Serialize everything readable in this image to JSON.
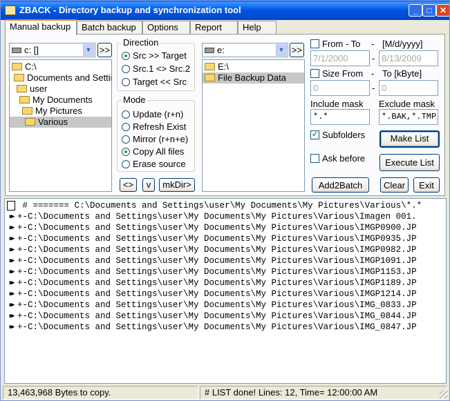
{
  "window": {
    "title": "ZBACK - Directory backup and synchronization tool",
    "controls": [
      "_",
      "□",
      "✕"
    ]
  },
  "tabs": [
    {
      "label": "Manual backup",
      "active": true
    },
    {
      "label": "Batch backup",
      "active": false
    },
    {
      "label": "Options",
      "active": false
    },
    {
      "label": "Report",
      "active": false
    },
    {
      "label": "Help",
      "active": false
    }
  ],
  "source": {
    "drive": "c: []",
    "nav_button": ">>",
    "tree": [
      {
        "label": "C:\\",
        "selected": false
      },
      {
        "label": "Documents and Settings",
        "selected": false
      },
      {
        "label": "user",
        "selected": false
      },
      {
        "label": "My Documents",
        "selected": false
      },
      {
        "label": "My Pictures",
        "selected": false
      },
      {
        "label": "Various",
        "selected": true
      }
    ]
  },
  "target": {
    "drive": "e:",
    "nav_button": ">>",
    "tree": [
      {
        "label": "E:\\",
        "selected": false
      },
      {
        "label": "File Backup Data",
        "selected": true
      }
    ]
  },
  "direction": {
    "legend": "Direction",
    "options": [
      {
        "label": "Src >> Target",
        "checked": true
      },
      {
        "label": "Src.1 <> Src.2",
        "checked": false
      },
      {
        "label": "Target << Src",
        "checked": false
      }
    ]
  },
  "mode": {
    "legend": "Mode",
    "options": [
      {
        "label": "Update (r+n)",
        "checked": false
      },
      {
        "label": "Refresh Exist",
        "checked": false
      },
      {
        "label": "Mirror (r+n+e)",
        "checked": false
      },
      {
        "label": "Copy All files",
        "checked": true
      },
      {
        "label": "Erase source",
        "checked": false
      }
    ]
  },
  "small_buttons": {
    "swap": "<>",
    "down": "v",
    "mkdir": "mkDir>"
  },
  "filters": {
    "from_to_label": "From  - To",
    "dash": "-",
    "date_format": "[M/d/yyyy]",
    "date_from": "7/1/2000",
    "date_to": "8/13/2009",
    "size_label": "Size From",
    "size_to_label": "To [kByte]",
    "size_from": "0",
    "size_to": "0",
    "include_label": "Include mask",
    "exclude_label": "Exclude mask",
    "include_mask": "*.*",
    "exclude_mask": "*.BAK,*.TMP",
    "subfolders_label": "Subfolders",
    "subfolders_checked": true,
    "ask_before_label": "Ask before",
    "ask_before_checked": false
  },
  "actions": {
    "make_list": "Make List",
    "execute_list": "Execute List",
    "add2batch": "Add2Batch",
    "clear": "Clear",
    "exit": "Exit"
  },
  "log": {
    "header": "# ======= C:\\Documents and Settings\\user\\My Documents\\My Pictures\\Various\\*.*",
    "lines": [
      "+-C:\\Documents and Settings\\user\\My Documents\\My Pictures\\Various\\Imagen 001.",
      "+-C:\\Documents and Settings\\user\\My Documents\\My Pictures\\Various\\IMGP0900.JP",
      "+-C:\\Documents and Settings\\user\\My Documents\\My Pictures\\Various\\IMGP0935.JP",
      "+-C:\\Documents and Settings\\user\\My Documents\\My Pictures\\Various\\IMGP0982.JP",
      "+-C:\\Documents and Settings\\user\\My Documents\\My Pictures\\Various\\IMGP1091.JP",
      "+-C:\\Documents and Settings\\user\\My Documents\\My Pictures\\Various\\IMGP1153.JP",
      "+-C:\\Documents and Settings\\user\\My Documents\\My Pictures\\Various\\IMGP1189.JP",
      "+-C:\\Documents and Settings\\user\\My Documents\\My Pictures\\Various\\IMGP1214.JP",
      "+-C:\\Documents and Settings\\user\\My Documents\\My Pictures\\Various\\IMG_0833.JP",
      "+-C:\\Documents and Settings\\user\\My Documents\\My Pictures\\Various\\IMG_0844.JP",
      "+-C:\\Documents and Settings\\user\\My Documents\\My Pictures\\Various\\IMG_0847.JP"
    ]
  },
  "status": {
    "left": "13,463,968 Bytes to copy.",
    "right": "# LIST done!  Lines: 12, Time= 12:00:00 AM"
  }
}
